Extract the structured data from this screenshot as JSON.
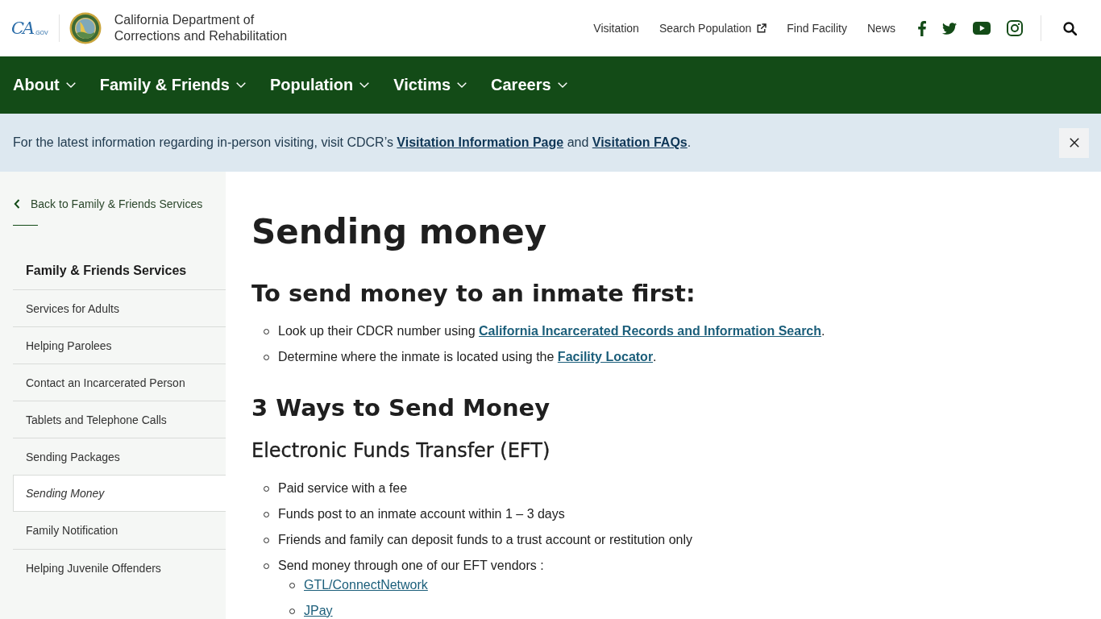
{
  "header": {
    "state_logo": {
      "mark": "CA",
      "suffix": ".GOV"
    },
    "org_name_lines": [
      "California Department of",
      "Corrections and Rehabilitation"
    ],
    "utility_links": [
      {
        "label": "Visitation",
        "external": false
      },
      {
        "label": "Search Population",
        "external": true
      },
      {
        "label": "Find Facility",
        "external": false
      },
      {
        "label": "News",
        "external": false
      }
    ],
    "social_links": [
      {
        "kind": "facebook"
      },
      {
        "kind": "twitter"
      },
      {
        "kind": "youtube"
      },
      {
        "kind": "instagram"
      }
    ]
  },
  "main_nav": [
    {
      "label": "About"
    },
    {
      "label": "Family & Friends"
    },
    {
      "label": "Population"
    },
    {
      "label": "Victims"
    },
    {
      "label": "Careers"
    }
  ],
  "alert": {
    "parts": [
      {
        "kind": "text",
        "text": "For the latest information regarding in-person visiting, visit CDCR’s "
      },
      {
        "kind": "strong_link",
        "text": "Visitation Information Page"
      },
      {
        "kind": "text",
        "text": " and "
      },
      {
        "kind": "strong_link",
        "text": "Visitation FAQs"
      },
      {
        "kind": "text",
        "text": "."
      }
    ]
  },
  "sidebar": {
    "back_link": "Back to Family & Friends Services",
    "heading": "Family & Friends Services",
    "items": [
      {
        "label": "Services for Adults",
        "selected": false
      },
      {
        "label": "Helping Parolees",
        "selected": false
      },
      {
        "label": "Contact an Incarcerated Person",
        "selected": false
      },
      {
        "label": "Tablets and Telephone Calls",
        "selected": false
      },
      {
        "label": "Sending Packages",
        "selected": false
      },
      {
        "label": "Sending Money",
        "selected": true
      },
      {
        "label": "Family Notification",
        "selected": false
      },
      {
        "label": "Helping Juvenile Offenders",
        "selected": false
      }
    ]
  },
  "content": {
    "title": "Sending money",
    "blocks": [
      {
        "kind": "heading",
        "text": "To send money to an inmate first:"
      },
      {
        "kind": "list",
        "items": [
          {
            "parts": [
              {
                "kind": "text",
                "text": "Look up their CDCR number using "
              },
              {
                "kind": "strong_link",
                "text": "California Incarcerated Records and Information Search"
              },
              {
                "kind": "text",
                "text": "."
              }
            ]
          },
          {
            "parts": [
              {
                "kind": "text",
                "text": "Determine where the inmate is located using the "
              },
              {
                "kind": "strong_link",
                "text": "Facility Locator"
              },
              {
                "kind": "text",
                "text": "."
              }
            ]
          }
        ]
      },
      {
        "kind": "heading",
        "text": "3 Ways to Send Money"
      },
      {
        "kind": "subheading",
        "text": "Electronic Funds Transfer (EFT)"
      },
      {
        "kind": "list",
        "items": [
          {
            "parts": [
              {
                "kind": "text",
                "text": "Paid service with a fee"
              }
            ]
          },
          {
            "parts": [
              {
                "kind": "text",
                "text": "Funds post to an inmate account within 1 – 3 days"
              }
            ]
          },
          {
            "parts": [
              {
                "kind": "text",
                "text": "Friends and family can deposit funds to a trust account or restitution only"
              }
            ]
          },
          {
            "parts": [
              {
                "kind": "text",
                "text": "Send money through one of our EFT vendors :"
              }
            ],
            "children": [
              {
                "parts": [
                  {
                    "kind": "link",
                    "text": "GTL/ConnectNetwork"
                  }
                ]
              },
              {
                "parts": [
                  {
                    "kind": "link",
                    "text": "JPay"
                  }
                ]
              }
            ]
          }
        ]
      }
    ]
  }
}
